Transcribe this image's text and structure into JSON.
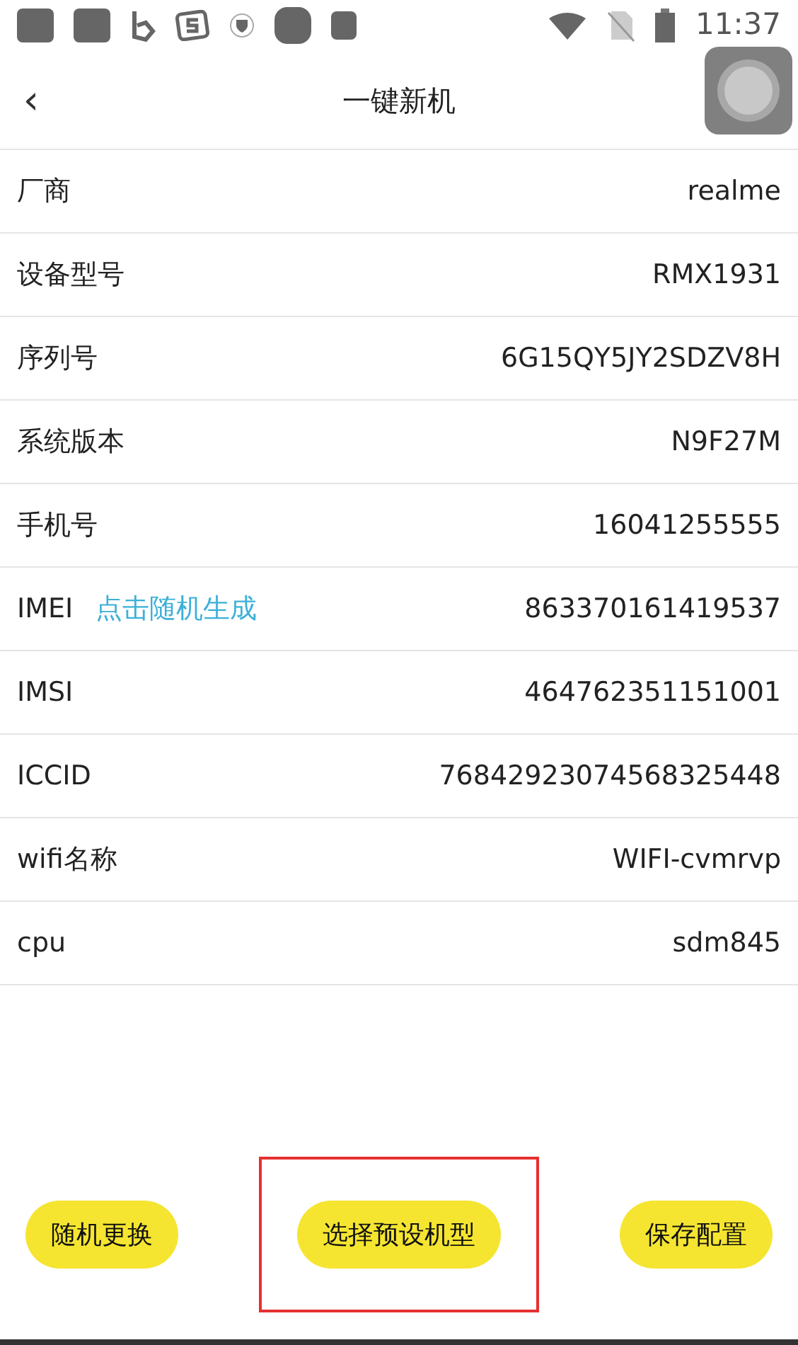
{
  "status_bar": {
    "time": "11:37"
  },
  "header": {
    "back": "‹",
    "title": "一键新机"
  },
  "rows": [
    {
      "label": "厂商",
      "value": "realme"
    },
    {
      "label": "设备型号",
      "value": "RMX1931"
    },
    {
      "label": "序列号",
      "value": "6G15QY5JY2SDZV8H"
    },
    {
      "label": "系统版本",
      "value": "N9F27M"
    },
    {
      "label": "手机号",
      "value": "16041255555"
    },
    {
      "label": "IMEI",
      "link": "点击随机生成",
      "value": "863370161419537"
    },
    {
      "label": "IMSI",
      "value": "464762351151001"
    },
    {
      "label": "ICCID",
      "value": "76842923074568325448"
    },
    {
      "label": "wifi名称",
      "value": "WIFI-cvmrvp"
    },
    {
      "label": "cpu",
      "value": "sdm845"
    }
  ],
  "buttons": [
    {
      "label": "随机更换",
      "highlighted": false
    },
    {
      "label": "选择预设机型",
      "highlighted": true
    },
    {
      "label": "保存配置",
      "highlighted": false
    }
  ]
}
